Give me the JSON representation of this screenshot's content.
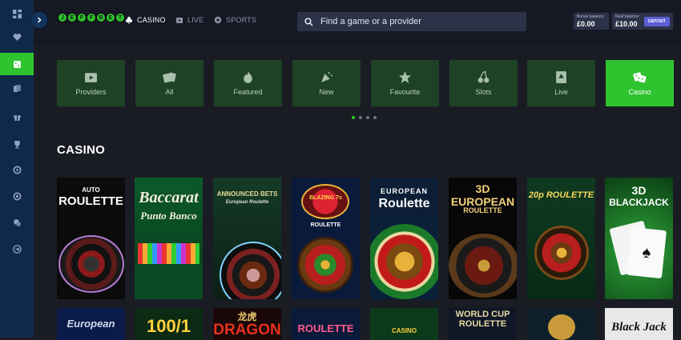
{
  "logo": {
    "letters": [
      "J",
      "E",
      "F",
      "F",
      "B",
      "E",
      "T"
    ]
  },
  "nav": {
    "casino": "CASINO",
    "live": "LIVE",
    "sports": "SPORTS"
  },
  "search": {
    "placeholder": "Find a game or a provider"
  },
  "balances": {
    "bonus_label": "Bonus balance:",
    "bonus_value": "£0.00",
    "real_label": "Real balance:",
    "real_value": "£10.00",
    "deposit": "DEPOSIT"
  },
  "categories": [
    {
      "label": "Providers",
      "icon": "play-window-icon"
    },
    {
      "label": "All",
      "icon": "cards-icon"
    },
    {
      "label": "Featured",
      "icon": "flame-icon"
    },
    {
      "label": "New",
      "icon": "party-popper-icon"
    },
    {
      "label": "Favourite",
      "icon": "star-icon"
    },
    {
      "label": "Slots",
      "icon": "cherries-icon"
    },
    {
      "label": "Live",
      "icon": "ace-card-icon"
    },
    {
      "label": "Casino",
      "icon": "dice-icon"
    }
  ],
  "section_title": "CASINO",
  "games_row1": [
    {
      "line1": "AUTO",
      "line2": "ROULETTE"
    },
    {
      "line1": "Baccarat",
      "line2": "Punto Banco"
    },
    {
      "line1": "ANNOUNCED BETS",
      "line2": "European Roulette"
    },
    {
      "line1": "BLAZING 7s",
      "line2": "ROULETTE"
    },
    {
      "line1": "EUROPEAN",
      "line2": "Roulette"
    },
    {
      "line1": "3D EUROPEAN",
      "line2": "ROULETTE"
    },
    {
      "line1": "20p ROULETTE",
      "line2": ""
    },
    {
      "line1": "3D",
      "line2": "BLACKJACK"
    }
  ],
  "games_row2": [
    {
      "label": "European"
    },
    {
      "label": "100/1"
    },
    {
      "label": "DRAGON",
      "sub": "龙虎"
    },
    {
      "label": "ROULETTE"
    },
    {
      "label": "CASINO"
    },
    {
      "label": "WORLD CUP ROULETTE"
    },
    {
      "label": ""
    },
    {
      "label": "Black Jack"
    }
  ],
  "colors": {
    "accent": "#2fc32f",
    "sidebar": "#10294a",
    "bg": "#1a1c24",
    "category_bg": "#1e4226",
    "deposit": "#5b5fd6"
  }
}
